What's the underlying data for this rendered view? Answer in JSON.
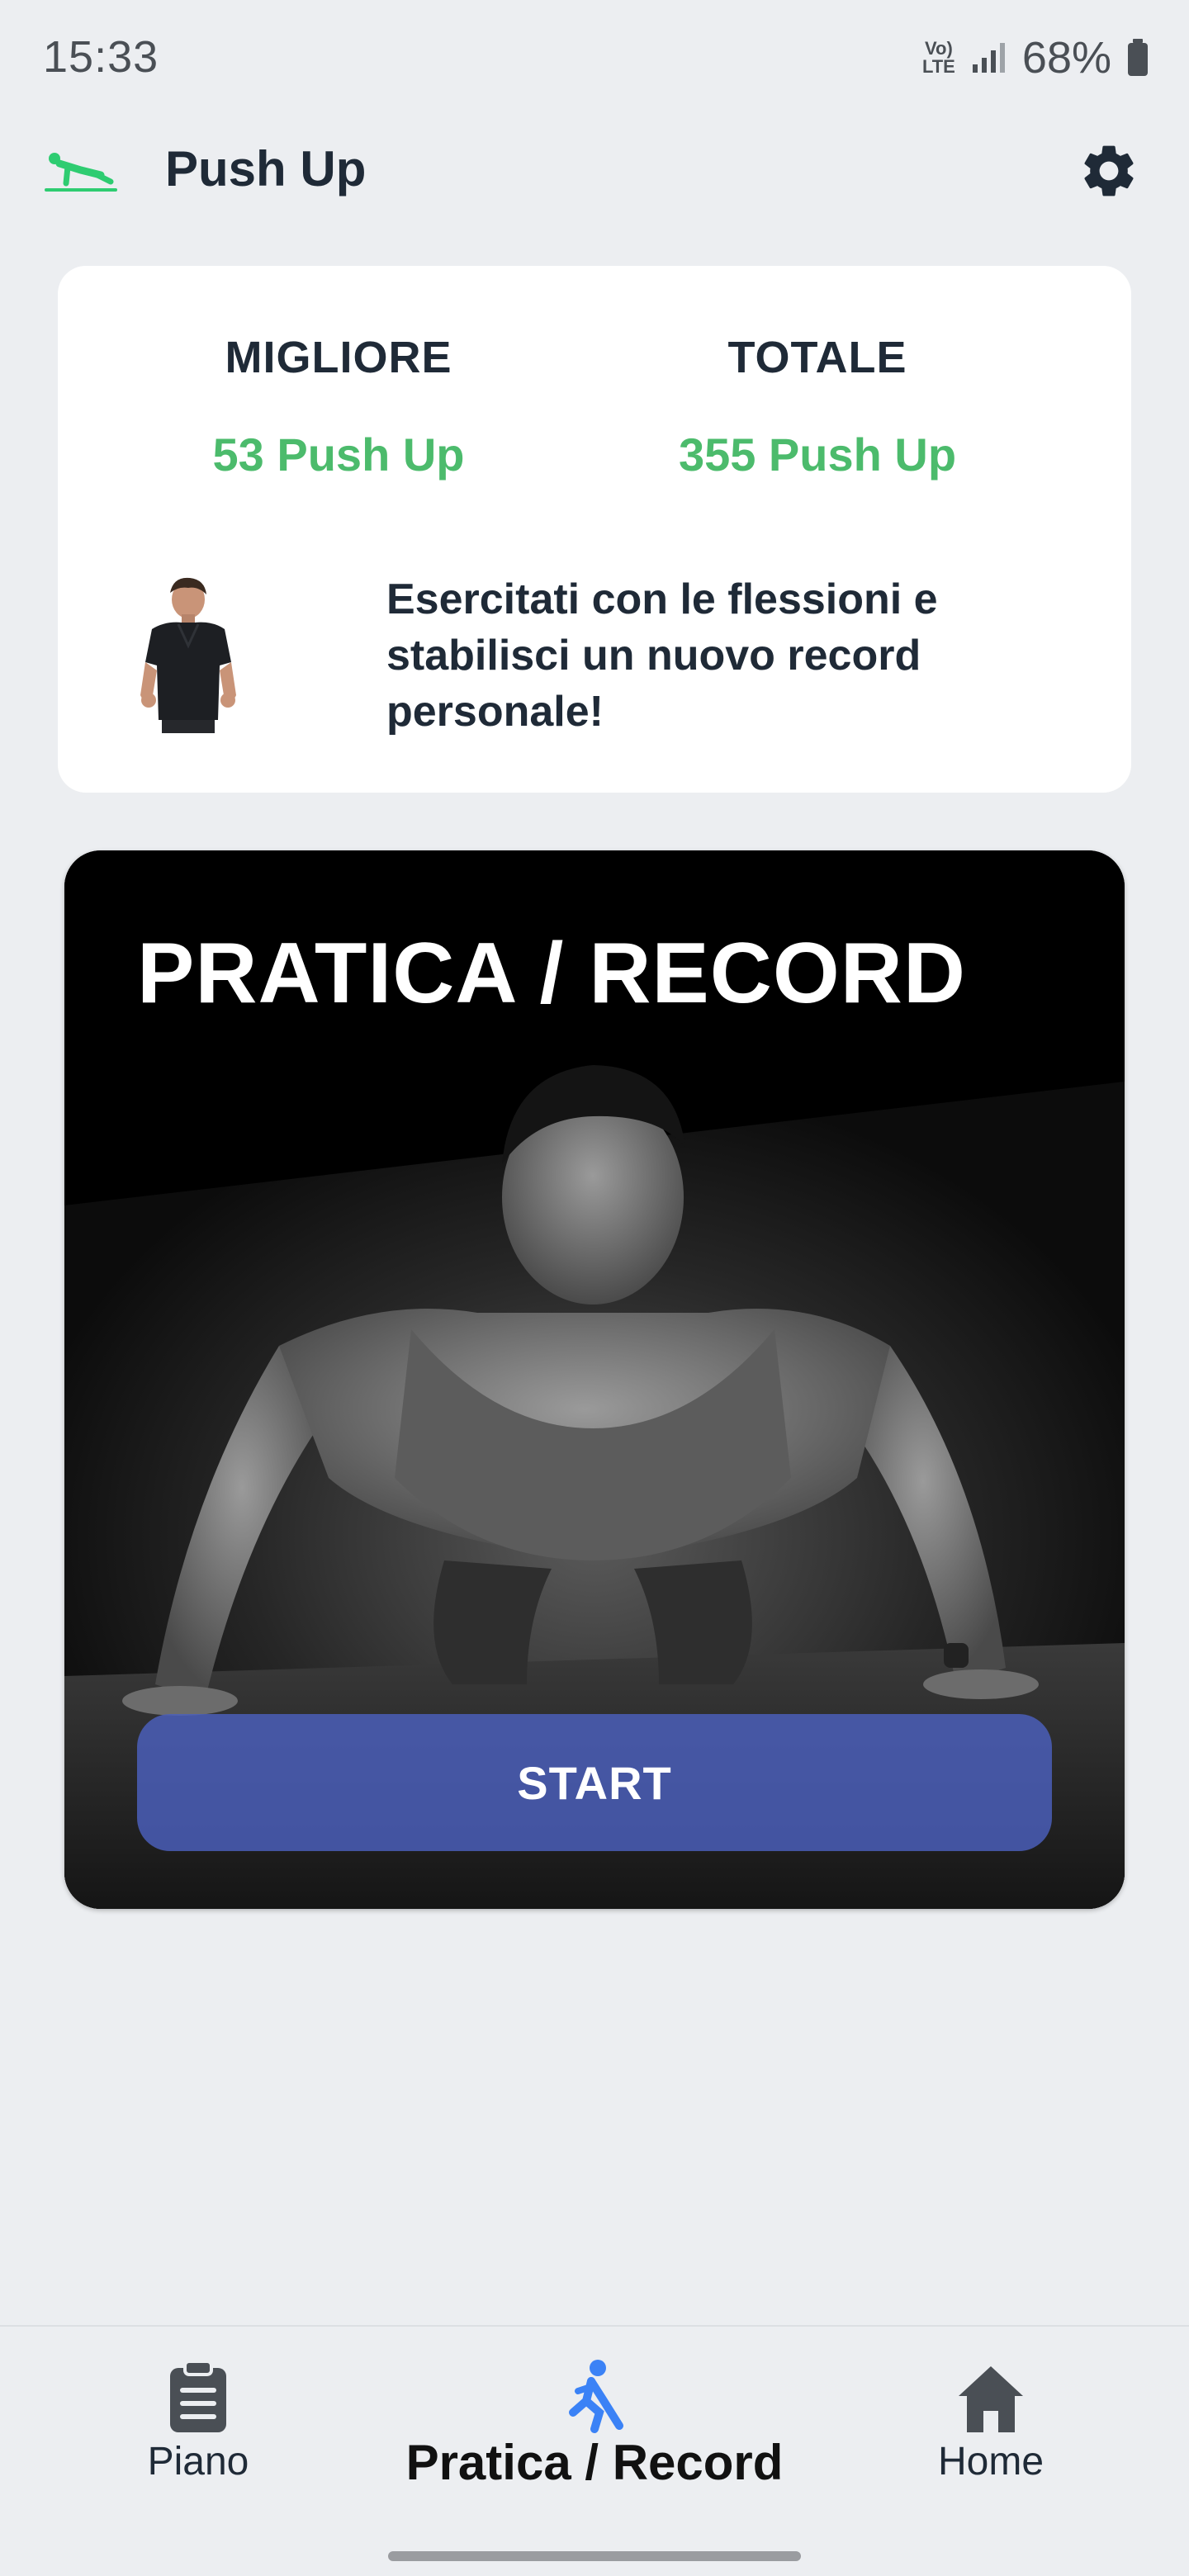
{
  "status_bar": {
    "time": "15:33",
    "network": "Vo) LTE",
    "battery": "68%"
  },
  "app_bar": {
    "title": "Push Up",
    "settings_icon": "gear-icon",
    "logo_icon": "pushup-logo-icon"
  },
  "stats": {
    "best_label": "MIGLIORE",
    "best_value": "53 Push Up",
    "total_label": "TOTALE",
    "total_value": "355 Push Up",
    "motivation": "Esercitati con le flessioni e stabilisci un nuovo record personale!"
  },
  "practice": {
    "title": "PRATICA / RECORD",
    "start_label": "START"
  },
  "bottom_nav": {
    "items": [
      {
        "label": "Piano",
        "icon": "clipboard-icon"
      },
      {
        "label": "Pratica / Record",
        "icon": "exercise-figure-icon",
        "active": true
      },
      {
        "label": "Home",
        "icon": "home-icon"
      }
    ]
  },
  "colors": {
    "accent_green": "#4cbb6c",
    "accent_blue": "#4c60be",
    "active_icon": "#3b82f6",
    "text_dark": "#1f2a37",
    "background": "#eceef1"
  }
}
